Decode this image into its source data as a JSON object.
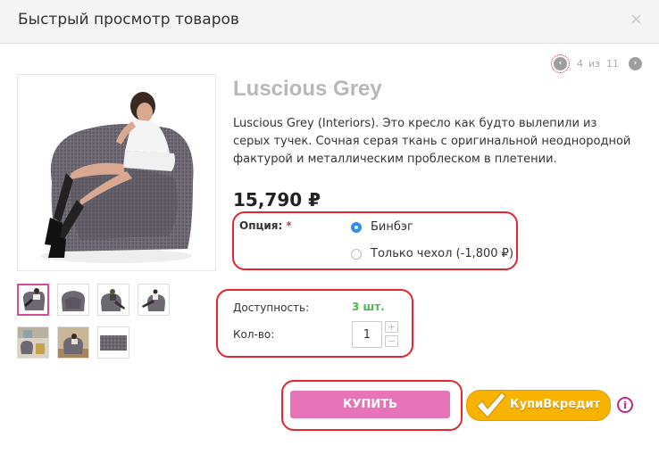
{
  "modal": {
    "title": "Быстрый просмотр товаров",
    "close_symbol": "×"
  },
  "pager": {
    "current": "4",
    "of": "из",
    "total": "11",
    "prev_symbol": "‹",
    "next_symbol": "›"
  },
  "product": {
    "title": "Luscious Grey",
    "description": "Luscious Grey (Interiors). Это кресло как будто вылепили из серых тучек. Сочная серая ткань с оригинальной неоднородной фактурой и металлическим проблеском в плетении.",
    "price": "15,790 ₽"
  },
  "option": {
    "label": "Опция:",
    "required_mark": "*",
    "choices": [
      {
        "label": "Бинбэг",
        "checked": true
      },
      {
        "label": "Только чехол (-1,800 ₽)",
        "checked": false
      }
    ]
  },
  "availability": {
    "label": "Доступность:",
    "value": "3 шт."
  },
  "quantity": {
    "label": "Кол-во:",
    "value": "1",
    "plus": "+",
    "minus": "−"
  },
  "actions": {
    "buy_label": "КУПИТЬ",
    "credit_label": "КупиВкредит",
    "info_symbol": "i"
  },
  "colors": {
    "accent_pink": "#e774b8",
    "stock_green": "#4cb94c",
    "highlight_red": "#e3262f",
    "credit_yellow": "#f8b300"
  },
  "thumbnails": [
    "chair-with-woman",
    "chair-front",
    "chair-with-man",
    "chair-with-woman-side",
    "chair-interior-1",
    "chair-interior-2",
    "fabric-swatch"
  ]
}
